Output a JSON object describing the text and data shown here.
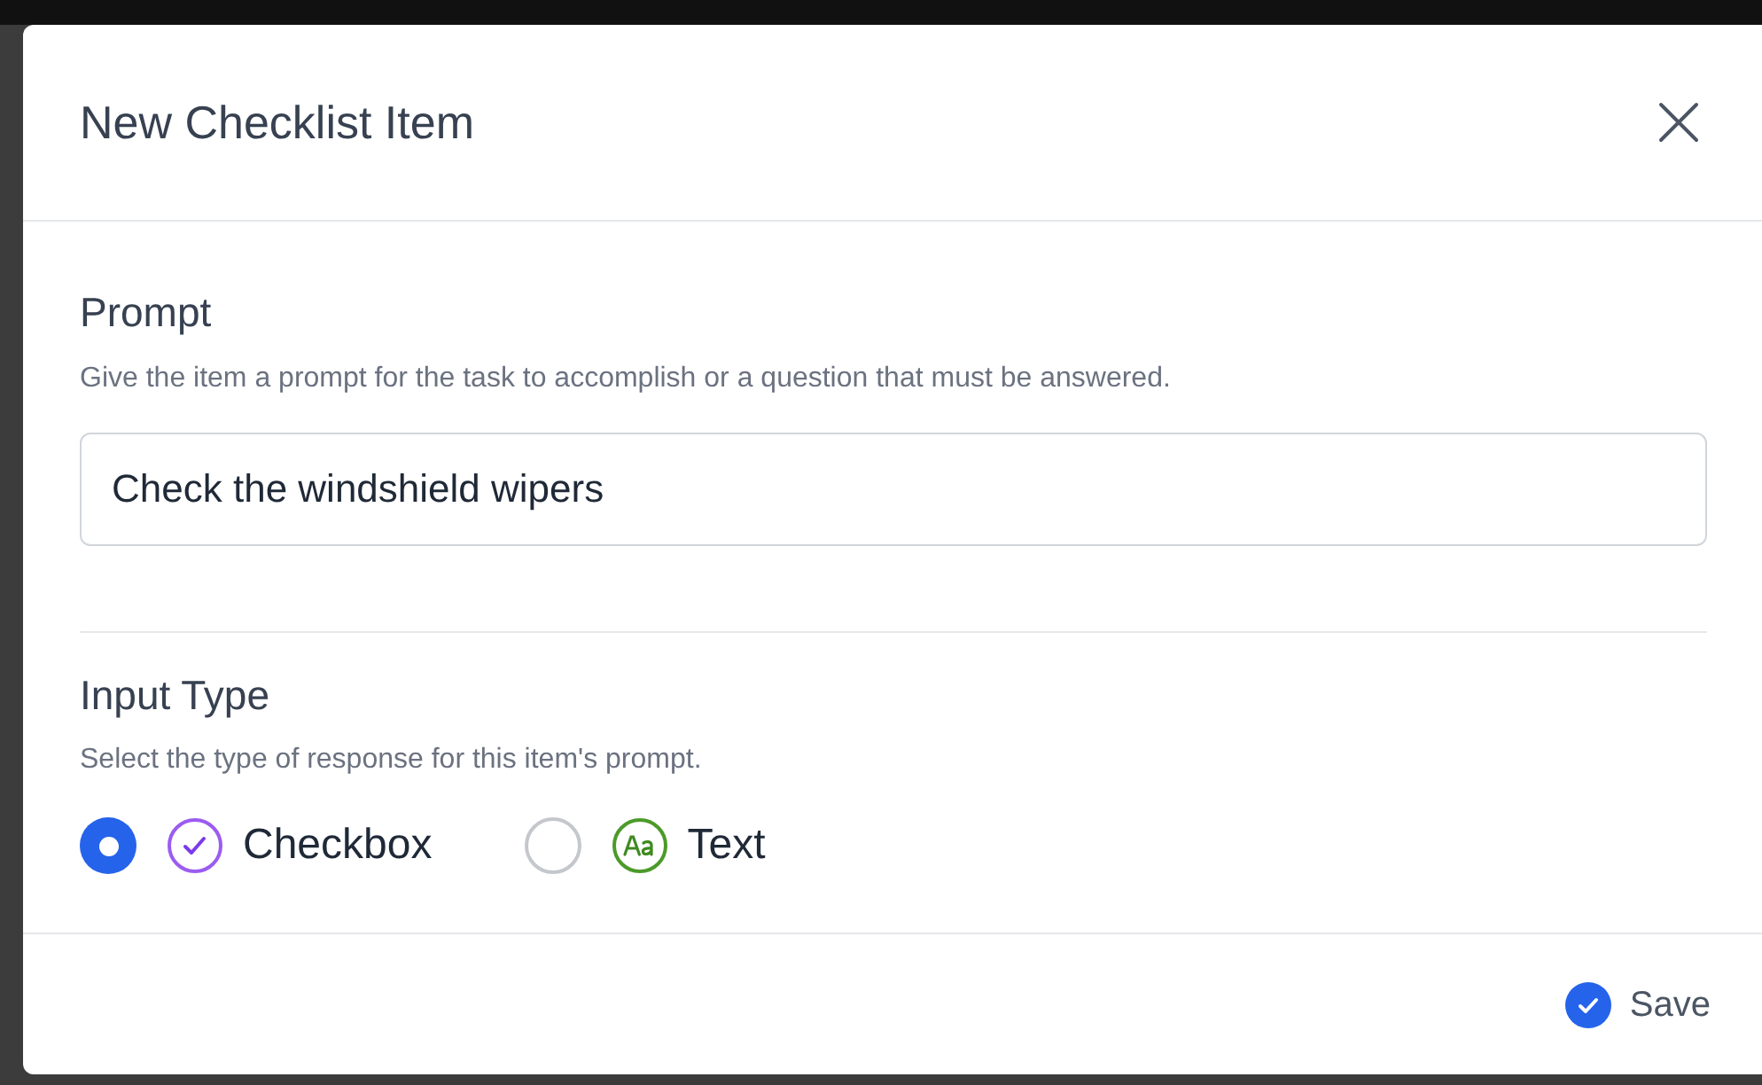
{
  "dialog": {
    "title": "New Checklist Item"
  },
  "prompt": {
    "label": "Prompt",
    "help": "Give the item a prompt for the task to accomplish or a question that must be answered.",
    "value": "Check the windshield wipers"
  },
  "input_type": {
    "label": "Input Type",
    "help": "Select the type of response for this item's prompt.",
    "options": [
      {
        "kind": "checkbox",
        "label": "Checkbox",
        "selected": true
      },
      {
        "kind": "text",
        "label": "Text",
        "selected": false
      }
    ]
  },
  "footer": {
    "save": "Save"
  }
}
